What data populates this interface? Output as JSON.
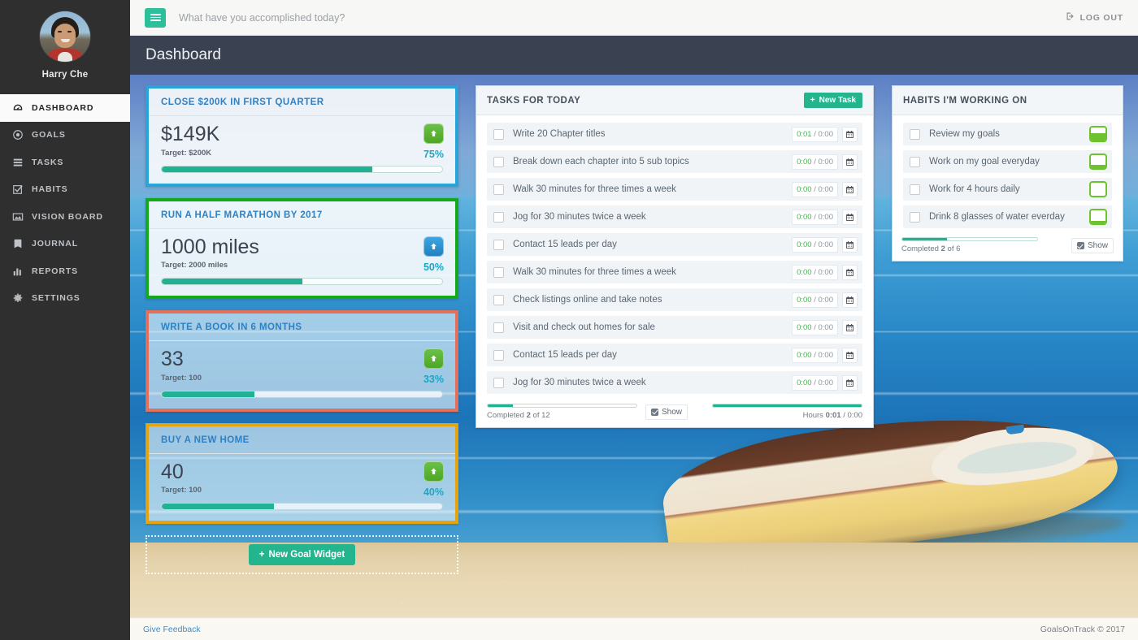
{
  "sidebar": {
    "user_name": "Harry Che",
    "items": [
      {
        "label": "DASHBOARD",
        "icon": "dashboard-icon",
        "active": true
      },
      {
        "label": "GOALS",
        "icon": "target-icon",
        "active": false
      },
      {
        "label": "TASKS",
        "icon": "list-icon",
        "active": false
      },
      {
        "label": "HABITS",
        "icon": "check-square-icon",
        "active": false
      },
      {
        "label": "VISION BOARD",
        "icon": "image-icon",
        "active": false
      },
      {
        "label": "JOURNAL",
        "icon": "book-icon",
        "active": false
      },
      {
        "label": "REPORTS",
        "icon": "bar-chart-icon",
        "active": false
      },
      {
        "label": "SETTINGS",
        "icon": "gear-icon",
        "active": false
      }
    ]
  },
  "topbar": {
    "menu_icon": "hamburger-icon",
    "accomplished_placeholder": "What have you accomplished today?",
    "accomplished_value": "",
    "logout_label": "LOG OUT",
    "logout_icon": "sign-out-icon"
  },
  "page": {
    "title": "Dashboard"
  },
  "goal_widgets": [
    {
      "title": "CLOSE $200K IN FIRST QUARTER",
      "value": "$149K",
      "target": "Target: $200K",
      "percent_label": "75%",
      "percent": 75,
      "border_color": "#29a4d9",
      "arrow_color": "green",
      "arrow_icon": "arrow-up-icon"
    },
    {
      "title": "RUN A HALF MARATHON BY 2017",
      "value": "1000 miles",
      "target": "Target: 2000 miles",
      "percent_label": "50%",
      "percent": 50,
      "border_color": "#16a81b",
      "arrow_color": "blue",
      "arrow_icon": "arrow-up-icon"
    },
    {
      "title": "WRITE A BOOK IN 6 MONTHS",
      "value": "33",
      "target": "Target: 100",
      "percent_label": "33%",
      "percent": 33,
      "border_color": "#e2705c",
      "arrow_color": "green",
      "arrow_icon": "arrow-up-icon"
    },
    {
      "title": "BUY A NEW HOME",
      "value": "40",
      "target": "Target: 100",
      "percent_label": "40%",
      "percent": 40,
      "border_color": "#e5a310",
      "arrow_color": "green",
      "arrow_icon": "arrow-up-icon"
    }
  ],
  "new_goal_widget_button": {
    "label": "New Goal Widget",
    "icon": "plus-icon"
  },
  "tasks_panel": {
    "title": "TASKS FOR TODAY",
    "new_task_button": {
      "label": "New Task",
      "icon": "plus-icon"
    },
    "rows": [
      {
        "label": "Write 20 Chapter titles",
        "spent": "0:01",
        "estimate": "0:00",
        "checked": false
      },
      {
        "label": "Break down each chapter into 5 sub topics",
        "spent": "0:00",
        "estimate": "0:00",
        "checked": false
      },
      {
        "label": "Walk 30 minutes for three times a week",
        "spent": "0:00",
        "estimate": "0:00",
        "checked": false
      },
      {
        "label": "Jog for 30 minutes twice a week",
        "spent": "0:00",
        "estimate": "0:00",
        "checked": false
      },
      {
        "label": "Contact 15 leads per day",
        "spent": "0:00",
        "estimate": "0:00",
        "checked": false
      },
      {
        "label": "Walk 30 minutes for three times a week",
        "spent": "0:00",
        "estimate": "0:00",
        "checked": false
      },
      {
        "label": "Check listings online and take notes",
        "spent": "0:00",
        "estimate": "0:00",
        "checked": false
      },
      {
        "label": "Visit and check out homes for sale",
        "spent": "0:00",
        "estimate": "0:00",
        "checked": false
      },
      {
        "label": "Contact 15 leads per day",
        "spent": "0:00",
        "estimate": "0:00",
        "checked": false
      },
      {
        "label": "Jog for 30 minutes twice a week",
        "spent": "0:00",
        "estimate": "0:00",
        "checked": false
      }
    ],
    "footer": {
      "completed_prefix": "Completed",
      "completed_count": "2",
      "completed_suffix": "of 12",
      "completed_percent": 17,
      "show_label": "Show",
      "show_checked": true,
      "hours_prefix": "Hours",
      "hours_spent": "0:01",
      "hours_suffix": "/ 0:00",
      "hours_percent": 100
    }
  },
  "habits_panel": {
    "title": "HABITS I'M WORKING ON",
    "rows": [
      {
        "label": "Review my goals",
        "checked": false,
        "progress": 55
      },
      {
        "label": "Work on my goal everyday",
        "checked": false,
        "progress": 28
      },
      {
        "label": "Work for 4 hours daily",
        "checked": false,
        "progress": 0
      },
      {
        "label": "Drink 8 glasses of water everday",
        "checked": false,
        "progress": 18
      }
    ],
    "footer": {
      "completed_prefix": "Completed",
      "completed_count": "2",
      "completed_suffix": "of 6",
      "completed_percent": 33,
      "show_label": "Show",
      "show_checked": true
    }
  },
  "footer": {
    "feedback_label": "Give Feedback",
    "copyright": "GoalsOnTrack © 2017"
  },
  "colors": {
    "accent_green": "#24b48e",
    "progress_green": "#21b195",
    "habit_green": "#6ec22e",
    "title_blue": "#2f81c4",
    "percent_blue": "#1aa6c4",
    "sidebar_bg": "#2f2f2f",
    "page_head_bg": "#3a4150"
  }
}
